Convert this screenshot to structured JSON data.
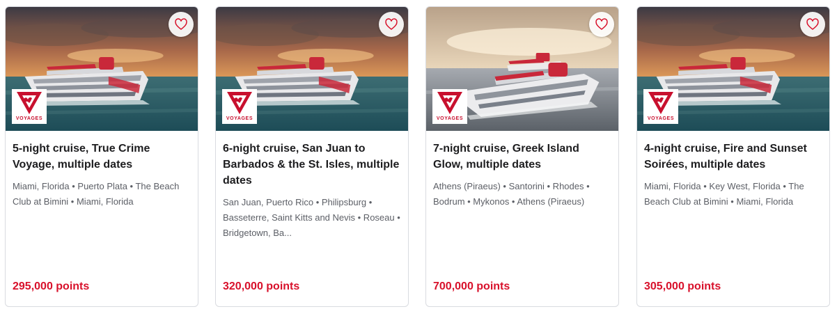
{
  "colors": {
    "accent": "#d8112b",
    "card_border": "#d9dbe0",
    "brand_red": "#c8102e"
  },
  "icons": {
    "favorite": "heart-outline-icon",
    "brand": "virgin-voyages-logo"
  },
  "cards": [
    {
      "title": "5-night cruise, True Crime Voyage, multiple dates",
      "ports": "Miami, Florida • Puerto Plata • The Beach Club at Bimini • Miami, Florida",
      "price": "295,000 points",
      "logo_text": "VOYAGES",
      "image_scene": "sunset-single-ship"
    },
    {
      "title": "6-night cruise, San Juan to Barbados & the St. Isles, multiple dates",
      "ports": "San Juan, Puerto Rico • Philipsburg • Basseterre, Saint Kitts and Nevis • Roseau • Bridgetown, Ba...",
      "price": "320,000 points",
      "logo_text": "VOYAGES",
      "image_scene": "sunset-single-ship"
    },
    {
      "title": "7-night cruise, Greek Island Glow, multiple dates",
      "ports": "Athens (Piraeus) • Santorini • Rhodes • Bodrum • Mykonos • Athens (Piraeus)",
      "price": "700,000 points",
      "logo_text": "VOYAGES",
      "image_scene": "two-ships-calm-sea"
    },
    {
      "title": "4-night cruise, Fire and Sunset Soirées, multiple dates",
      "ports": "Miami, Florida • Key West, Florida • The Beach Club at Bimini • Miami, Florida",
      "price": "305,000 points",
      "logo_text": "VOYAGES",
      "image_scene": "sunset-single-ship"
    }
  ]
}
